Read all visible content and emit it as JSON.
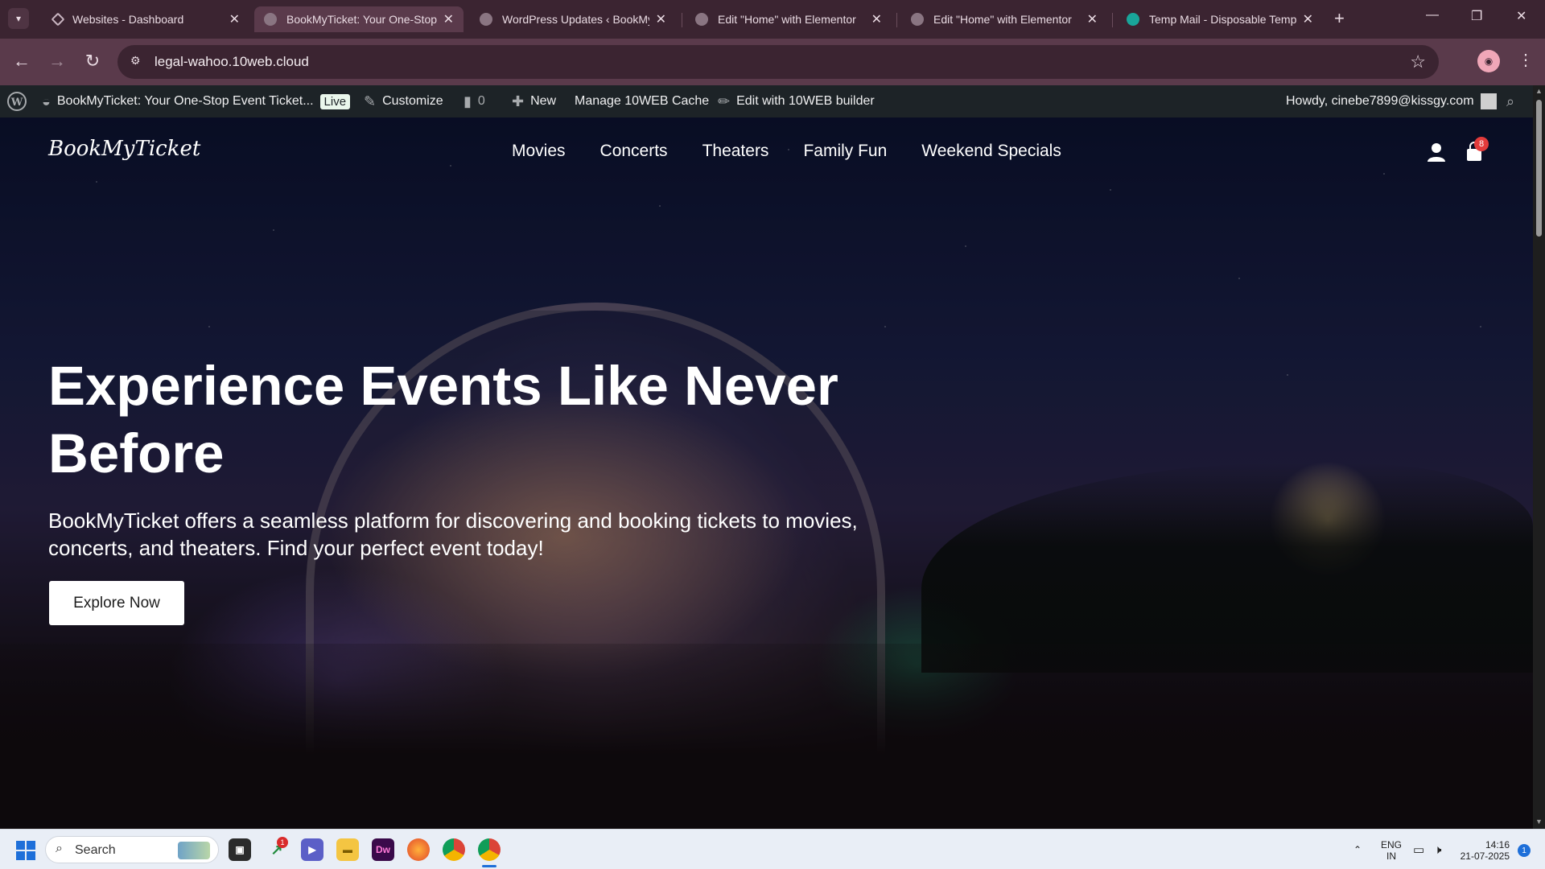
{
  "browser": {
    "tabs": [
      {
        "title": "Websites - Dashboard",
        "active": false
      },
      {
        "title": "BookMyTicket: Your One-Stop",
        "active": true
      },
      {
        "title": "WordPress Updates ‹ BookMyT",
        "active": false
      },
      {
        "title": "Edit \"Home\" with Elementor",
        "active": false
      },
      {
        "title": "Edit \"Home\" with Elementor",
        "active": false
      },
      {
        "title": "Temp Mail - Disposable Tempo",
        "active": false
      }
    ],
    "url": "legal-wahoo.10web.cloud"
  },
  "adminbar": {
    "site_name": "BookMyTicket: Your One-Stop Event Ticket...",
    "live_badge": "Live",
    "customize": "Customize",
    "comments_count": "0",
    "new": "New",
    "cache": "Manage 10WEB Cache",
    "builder": "Edit with 10WEB builder",
    "howdy": "Howdy, cinebe7899@kissgy.com"
  },
  "site": {
    "logo": "BookMyTicket",
    "nav": [
      "Movies",
      "Concerts",
      "Theaters",
      "Family Fun",
      "Weekend Specials"
    ],
    "cart_count": "8"
  },
  "hero": {
    "title": "Experience Events Like Never Before",
    "subtitle": "BookMyTicket offers a seamless platform for discovering and booking tickets to movies, concerts, and theaters. Find your perfect event today!",
    "button": "Explore Now"
  },
  "taskbar": {
    "search_placeholder": "Search",
    "badge_count": "1",
    "lang_line1": "ENG",
    "lang_line2": "IN",
    "time": "14:16",
    "date": "21-07-2025",
    "notifications": "1"
  },
  "colors": {
    "tab_strip": "#3b2431",
    "toolbar": "#5a3a4b",
    "adminbar": "#1d2327",
    "taskbar": "#e9eef6",
    "badge_red": "#e33b3b"
  }
}
